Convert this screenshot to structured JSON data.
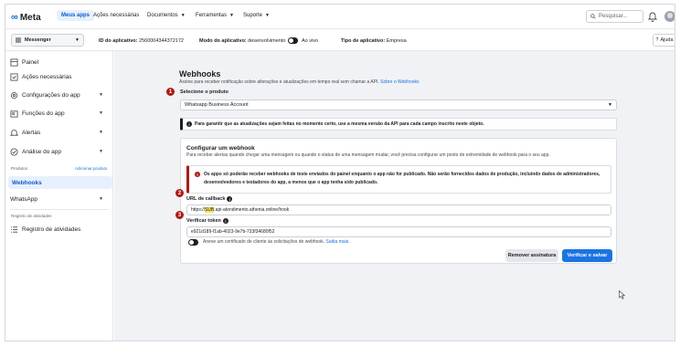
{
  "nav": {
    "logo": "Meta",
    "items": [
      {
        "label": "Meus apps",
        "active": true
      },
      {
        "label": "Ações necessárias"
      },
      {
        "label": "Documentos"
      },
      {
        "label": "Ferramentas"
      },
      {
        "label": "Suporte"
      }
    ],
    "search_placeholder": "Pesquisar..."
  },
  "appbar": {
    "app_name": "Messenger",
    "app_id_label": "ID do aplicativo:",
    "app_id": "2560004344372172",
    "mode_label": "Modo do aplicativo:",
    "mode_value": "desenvolvimento",
    "live_label": "Ao vivo",
    "type_label": "Tipo de aplicativo:",
    "type_value": "Empresa",
    "help_label": "Ajuda"
  },
  "sidebar": {
    "items": [
      {
        "label": "Painel",
        "icon": "dashboard-icon"
      },
      {
        "label": "Ações necessárias",
        "icon": "checklist-icon"
      },
      {
        "label": "Configurações do app",
        "icon": "gear-icon"
      },
      {
        "label": "Funções do app",
        "icon": "roles-icon"
      },
      {
        "label": "Alertas",
        "icon": "bell-icon"
      },
      {
        "label": "Análise do app",
        "icon": "check-circle-icon"
      }
    ],
    "products_label": "Produtos",
    "add_product_label": "Adicionar produto",
    "webhooks_label": "Webhooks",
    "whatsapp_label": "WhatsApp",
    "activity_section_label": "Registro de atividades",
    "activity_item_label": "Registro de atividades"
  },
  "main": {
    "title": "Webhooks",
    "subtitle": "Assine para receber notificação sobre alterações e atualizações em tempo real sem chamar a API.",
    "subtitle_link": "Sobre o Webhooks",
    "select_product_label": "Selecione o produto",
    "selected_product": "Whatsapp Business Account",
    "notice": "Para garantir que as atualizações sejam feitas no momento certo, use a mesma versão da API para cada campo inscrito neste objeto.",
    "card": {
      "title": "Configurar um webhook",
      "subtitle": "Para receber alertas quando chegar uma mensagem ou quando o status de uma mensagem mudar, você precisa configurar um ponto de extremidade de webhook para o seu app.",
      "warning": "Os apps só poderão receber webhooks de teste enviados do painel enquanto o app não for publicado. Não serão fornecidos dados de produção, incluindo dados de administradores, desenvolvedores e testadores do app, a menos que o app tenha sido publicado.",
      "callback_label": "URL de callback",
      "callback_prefix": "https://",
      "callback_highlight": "SUB",
      "callback_suffix": ".api-atendimento.athenia.online/hook",
      "token_label": "Verificar token",
      "token_value": "e921d189-f1ab-4023-9e7b-733f34680f52",
      "cert_text": "Anexe um certificado de cliente às solicitações de webhook.",
      "cert_link": "Saiba mais.",
      "remove_button": "Remover assinatura",
      "verify_button": "Verificar e salvar"
    },
    "step_badges": [
      "1",
      "2",
      "3"
    ]
  },
  "colors": {
    "brand_blue": "#1b74e4",
    "badge_red": "#b3180f",
    "highlight_yellow": "#f7e35c"
  }
}
